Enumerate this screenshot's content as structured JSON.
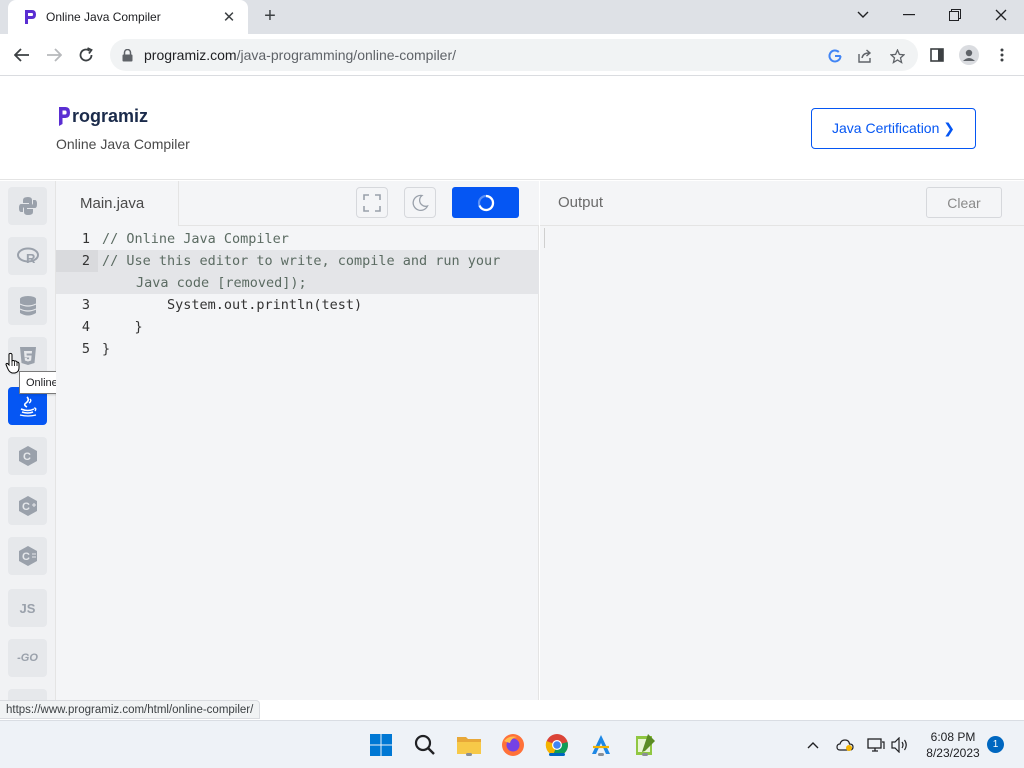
{
  "browser": {
    "tab_title": "Online Java Compiler",
    "tab_close": "✕",
    "new_tab": "+",
    "url_host": "programiz.com",
    "url_path": "/java-programming/online-compiler/",
    "status_url": "https://www.programiz.com/html/online-compiler/"
  },
  "header": {
    "logo_text": "rogramiz",
    "subtitle": "Online Java Compiler",
    "cert_button": "Java Certification ❯"
  },
  "sidebar": {
    "tooltip": "Online HTML/CSS Editor",
    "items": [
      {
        "name": "python",
        "label": ""
      },
      {
        "name": "r",
        "label": ""
      },
      {
        "name": "sql",
        "label": ""
      },
      {
        "name": "html",
        "label": ""
      },
      {
        "name": "java",
        "label": ""
      },
      {
        "name": "c",
        "label": "C"
      },
      {
        "name": "cpp",
        "label": "C"
      },
      {
        "name": "csharp",
        "label": "C"
      },
      {
        "name": "js",
        "label": "JS"
      },
      {
        "name": "go",
        "label": "-GO"
      }
    ]
  },
  "editor": {
    "file_name": "Main.java",
    "lines": [
      {
        "num": "1",
        "text": "// Online Java Compiler"
      },
      {
        "num": "2",
        "text": "// Use this editor to write, compile and run your",
        "wrap": "Java code [removed]);"
      },
      {
        "num": "3",
        "text": "        System.out.println(test)"
      },
      {
        "num": "4",
        "text": "    }"
      },
      {
        "num": "5",
        "text": "}"
      }
    ]
  },
  "output": {
    "title": "Output",
    "clear_button": "Clear"
  },
  "taskbar": {
    "time": "6:08 PM",
    "date": "8/23/2023",
    "notification_count": "1"
  }
}
